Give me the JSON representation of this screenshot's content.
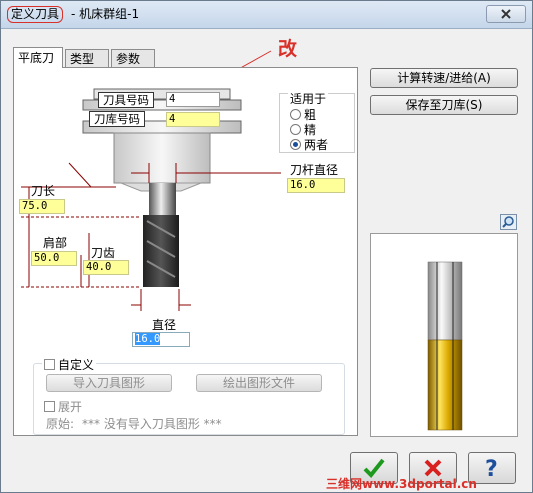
{
  "window": {
    "title_main": "定义刀具",
    "title_sub": "- 机床群组-1"
  },
  "tabs": [
    {
      "label": "平底刀",
      "active": true
    },
    {
      "label": "类型",
      "active": false
    },
    {
      "label": "参数",
      "active": false
    }
  ],
  "annotation": "改",
  "holder": {
    "tool_number_label": "刀具号码",
    "tool_number_value": "4",
    "library_number_label": "刀库号码",
    "library_number_value": "4"
  },
  "applies_to": {
    "title": "适用于",
    "options": [
      {
        "label": "粗",
        "selected": false
      },
      {
        "label": "精",
        "selected": false
      },
      {
        "label": "两者",
        "selected": true
      }
    ]
  },
  "dimensions": {
    "shank_diameter_label": "刀杆直径",
    "shank_diameter_value": "16.0",
    "overall_length_label": "刀长",
    "overall_length_value": "75.0",
    "shoulder_label": "肩部",
    "shoulder_value": "50.0",
    "flute_label": "刀齿",
    "flute_value": "40.0",
    "diameter_label": "直径",
    "diameter_value": "16.0"
  },
  "custom": {
    "checkbox_label": "自定义",
    "import_button": "导入刀具图形",
    "draw_button": "绘出图形文件",
    "expand_label": "展开",
    "origin_label": "原始:",
    "origin_value": "*** 没有导入刀具图形 ***"
  },
  "side_buttons": {
    "calc_feed": "计算转速/进给(A)",
    "save_library": "保存至刀库(S)"
  },
  "watermark": "三维网www.3dportal.cn",
  "colors": {
    "highlight_field": "#ffff99",
    "annotation_red": "#d9302a",
    "tool_gold": "#d9a800"
  }
}
